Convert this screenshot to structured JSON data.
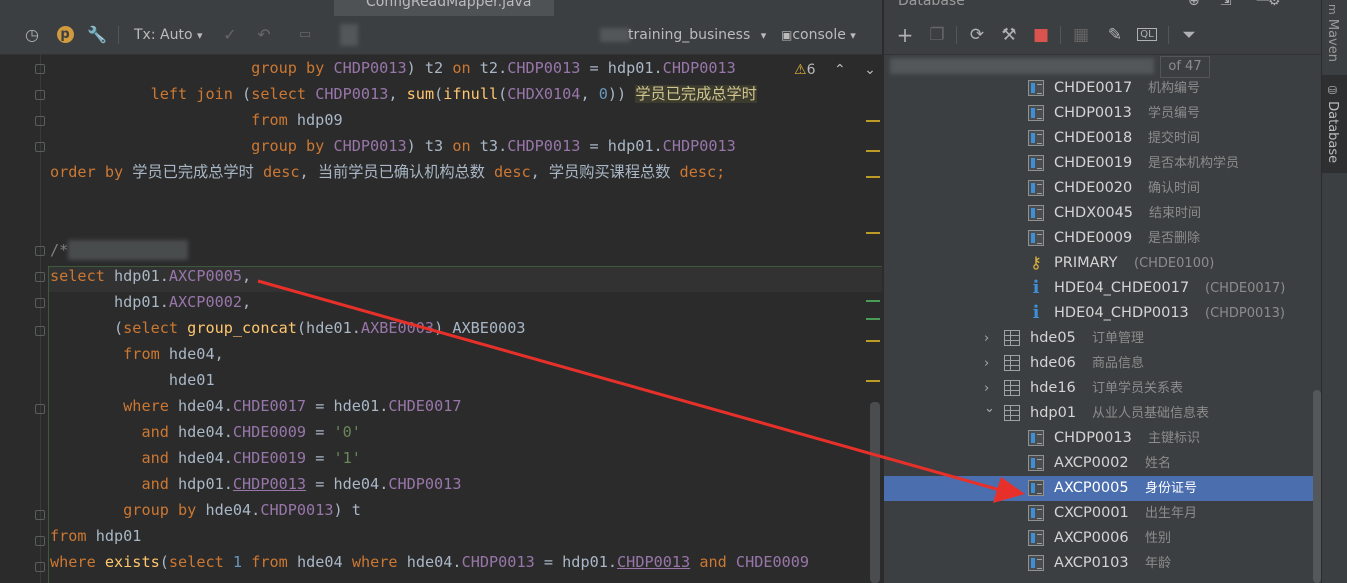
{
  "tab": {
    "file": "ConfigReadMapper.java"
  },
  "toolbar": {
    "tx_mode": "Tx: Auto",
    "schema": "training_business",
    "session": "console"
  },
  "inspections": {
    "warning_count": "6"
  },
  "code_lines": [
    [
      {
        "t": "                      "
      },
      {
        "t": "group by ",
        "c": "kw"
      },
      {
        "t": "CHDP0013",
        "c": "col"
      },
      {
        "t": ") t2 "
      },
      {
        "t": "on ",
        "c": "kw"
      },
      {
        "t": "t2."
      },
      {
        "t": "CHDP0013",
        "c": "col"
      },
      {
        "t": " = hdp01."
      },
      {
        "t": "CHDP0013",
        "c": "col"
      }
    ],
    [
      {
        "t": "           "
      },
      {
        "t": "left join ",
        "c": "kw"
      },
      {
        "t": "("
      },
      {
        "t": "select ",
        "c": "kw"
      },
      {
        "t": "CHDP0013",
        "c": "col"
      },
      {
        "t": ", "
      },
      {
        "t": "sum",
        "c": "fn"
      },
      {
        "t": "("
      },
      {
        "t": "ifnull",
        "c": "fn"
      },
      {
        "t": "("
      },
      {
        "t": "CHDX0104",
        "c": "col"
      },
      {
        "t": ", "
      },
      {
        "t": "0",
        "c": "num"
      },
      {
        "t": ")) "
      },
      {
        "t": "学员已完成总学时",
        "c": "hl"
      }
    ],
    [
      {
        "t": "                      "
      },
      {
        "t": "from ",
        "c": "kw"
      },
      {
        "t": "hdp09"
      }
    ],
    [
      {
        "t": "                      "
      },
      {
        "t": "group by ",
        "c": "kw"
      },
      {
        "t": "CHDP0013",
        "c": "col"
      },
      {
        "t": ") t3 "
      },
      {
        "t": "on ",
        "c": "kw"
      },
      {
        "t": "t3."
      },
      {
        "t": "CHDP0013",
        "c": "col"
      },
      {
        "t": " = hdp01."
      },
      {
        "t": "CHDP0013",
        "c": "col"
      }
    ],
    [
      {
        "t": "order by ",
        "c": "kw"
      },
      {
        "t": "学员已完成总学时 "
      },
      {
        "t": "desc",
        "c": "kw"
      },
      {
        "t": ", 当前学员已确认机构总数 "
      },
      {
        "t": "desc",
        "c": "kw"
      },
      {
        "t": ", 学员购买课程总数 "
      },
      {
        "t": "desc",
        "c": "kw"
      },
      {
        "t": ";",
        "c": "kw"
      }
    ],
    [],
    [],
    [
      {
        "t": "/*",
        "c": "cmt"
      }
    ],
    [
      {
        "t": "select ",
        "c": "kw"
      },
      {
        "t": "hdp01."
      },
      {
        "t": "AXCP0005",
        "c": "col"
      },
      {
        "t": ","
      }
    ],
    [
      {
        "t": "       hdp01."
      },
      {
        "t": "AXCP0002",
        "c": "col"
      },
      {
        "t": ","
      }
    ],
    [
      {
        "t": "       ("
      },
      {
        "t": "select ",
        "c": "kw"
      },
      {
        "t": "group_concat",
        "c": "fn"
      },
      {
        "t": "(hde01."
      },
      {
        "t": "AXBE0003",
        "c": "col"
      },
      {
        "t": ") AXBE0003"
      }
    ],
    [
      {
        "t": "        "
      },
      {
        "t": "from ",
        "c": "kw"
      },
      {
        "t": "hde04,"
      }
    ],
    [
      {
        "t": "             hde01"
      }
    ],
    [
      {
        "t": "        "
      },
      {
        "t": "where ",
        "c": "kw"
      },
      {
        "t": "hde04."
      },
      {
        "t": "CHDE0017",
        "c": "col"
      },
      {
        "t": " = hde01."
      },
      {
        "t": "CHDE0017",
        "c": "col"
      }
    ],
    [
      {
        "t": "          "
      },
      {
        "t": "and ",
        "c": "kw"
      },
      {
        "t": "hde04."
      },
      {
        "t": "CHDE0009",
        "c": "col"
      },
      {
        "t": " = "
      },
      {
        "t": "'0'",
        "c": "str"
      }
    ],
    [
      {
        "t": "          "
      },
      {
        "t": "and ",
        "c": "kw"
      },
      {
        "t": "hde04."
      },
      {
        "t": "CHDE0019",
        "c": "col"
      },
      {
        "t": " = "
      },
      {
        "t": "'1'",
        "c": "str"
      }
    ],
    [
      {
        "t": "          "
      },
      {
        "t": "and ",
        "c": "kw"
      },
      {
        "t": "hdp01."
      },
      {
        "t": "CHDP0013",
        "c": "col ul"
      },
      {
        "t": " = hde04."
      },
      {
        "t": "CHDP0013",
        "c": "col"
      }
    ],
    [
      {
        "t": "        "
      },
      {
        "t": "group by ",
        "c": "kw"
      },
      {
        "t": "hde04."
      },
      {
        "t": "CHDP0013",
        "c": "col"
      },
      {
        "t": ") t"
      }
    ],
    [
      {
        "t": "from ",
        "c": "kw"
      },
      {
        "t": "hdp01"
      }
    ],
    [
      {
        "t": "where ",
        "c": "kw"
      },
      {
        "t": "exists",
        "c": "fn"
      },
      {
        "t": "("
      },
      {
        "t": "select ",
        "c": "kw"
      },
      {
        "t": "1",
        "c": "num"
      },
      {
        "t": " "
      },
      {
        "t": "from ",
        "c": "kw"
      },
      {
        "t": "hde04 "
      },
      {
        "t": "where ",
        "c": "kw"
      },
      {
        "t": "hde04."
      },
      {
        "t": "CHDP0013",
        "c": "col"
      },
      {
        "t": " = hdp01."
      },
      {
        "t": "CHDP0013",
        "c": "col ul"
      },
      {
        "t": " "
      },
      {
        "t": "and ",
        "c": "kw"
      },
      {
        "t": "CHDE0009",
        "c": "col"
      }
    ]
  ],
  "database": {
    "title": "Database",
    "pager": "of 47",
    "rows": [
      {
        "type": "col",
        "name": "CHDE0017",
        "comment": "机构编号",
        "indent": 1
      },
      {
        "type": "col",
        "name": "CHDP0013",
        "comment": "学员编号",
        "indent": 1
      },
      {
        "type": "col",
        "name": "CHDE0018",
        "comment": "提交时间",
        "indent": 1
      },
      {
        "type": "col",
        "name": "CHDE0019",
        "comment": "是否本机构学员",
        "indent": 1
      },
      {
        "type": "col",
        "name": "CHDE0020",
        "comment": "确认时间",
        "indent": 1
      },
      {
        "type": "col",
        "name": "CHDX0045",
        "comment": "结束时间",
        "indent": 1
      },
      {
        "type": "col",
        "name": "CHDE0009",
        "comment": "是否删除",
        "indent": 1
      },
      {
        "type": "key",
        "name": "PRIMARY",
        "comment": "(CHDE0100)",
        "indent": 1
      },
      {
        "type": "idx",
        "name": "HDE04_CHDE0017",
        "comment": "(CHDE0017)",
        "indent": 1
      },
      {
        "type": "idx",
        "name": "HDE04_CHDP0013",
        "comment": "(CHDP0013)",
        "indent": 1
      },
      {
        "type": "table",
        "name": "hde05",
        "comment": "订单管理",
        "indent": 0,
        "arrow": "›"
      },
      {
        "type": "table",
        "name": "hde06",
        "comment": "商品信息",
        "indent": 0,
        "arrow": "›"
      },
      {
        "type": "table",
        "name": "hde16",
        "comment": "订单学员关系表",
        "indent": 0,
        "arrow": "›"
      },
      {
        "type": "table",
        "name": "hdp01",
        "comment": "从业人员基础信息表",
        "indent": 0,
        "arrow": "⌄"
      },
      {
        "type": "keycol",
        "name": "CHDP0013",
        "comment": "主键标识",
        "indent": 1
      },
      {
        "type": "col",
        "name": "AXCP0002",
        "comment": "姓名",
        "indent": 1
      },
      {
        "type": "col",
        "name": "AXCP0005",
        "comment": "身份证号",
        "indent": 1,
        "selected": true
      },
      {
        "type": "col",
        "name": "CXCP0001",
        "comment": "出生年月",
        "indent": 1
      },
      {
        "type": "col",
        "name": "AXCP0006",
        "comment": "性别",
        "indent": 1
      },
      {
        "type": "col",
        "name": "AXCP0103",
        "comment": "年龄",
        "indent": 1
      }
    ]
  },
  "side_tabs": {
    "maven": "Maven",
    "database": "Database"
  },
  "colors": {
    "annotation_arrow": "#e8302a",
    "selection": "#4b6eaf"
  }
}
